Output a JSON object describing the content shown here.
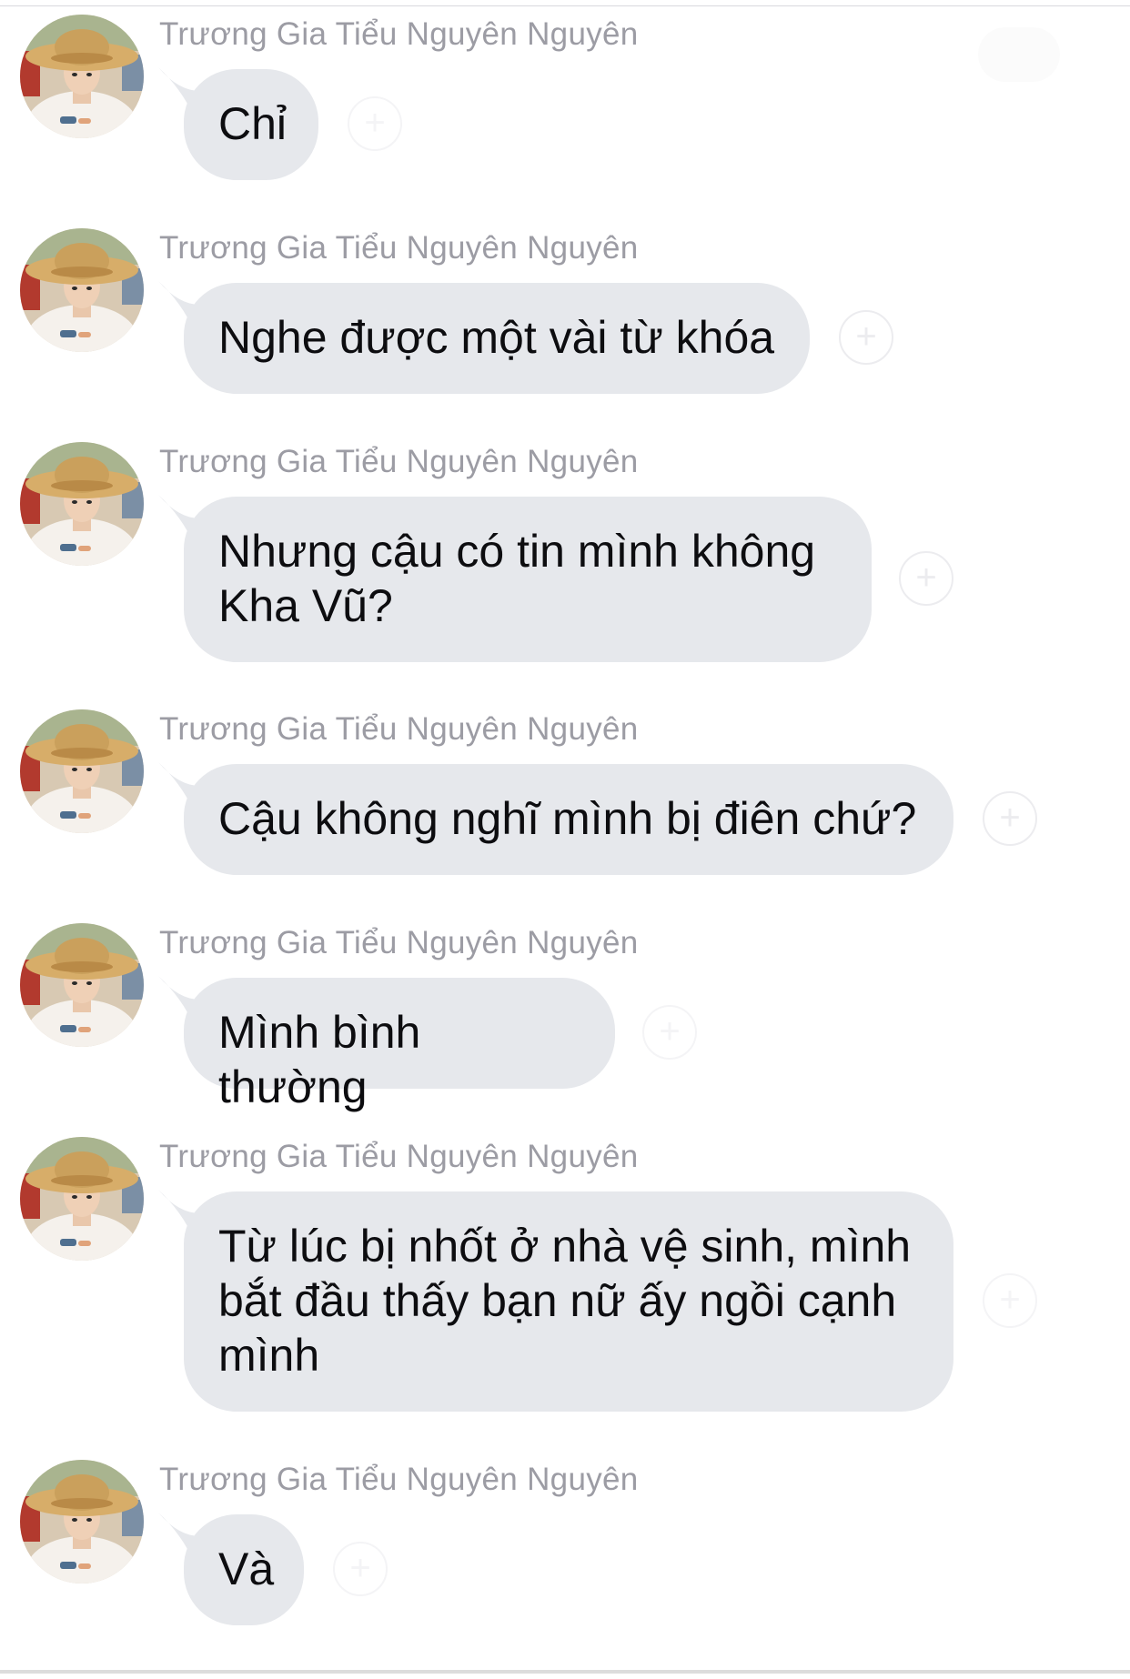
{
  "colors": {
    "bubble": "#e6e8ec",
    "sender_name": "#9c9ca4",
    "message_text": "#0d0d10",
    "react_ring": "#ececef"
  },
  "icons": {
    "add_reaction": "plus-circle-icon",
    "avatar": "profile-photo-straw-hat"
  },
  "react_glyph": "+",
  "messages": [
    {
      "sender": "Trương Gia Tiểu Nguyên Nguyên",
      "text": "Chỉ"
    },
    {
      "sender": "Trương Gia Tiểu Nguyên Nguyên",
      "text": "Nghe được một vài từ khóa"
    },
    {
      "sender": "Trương Gia Tiểu Nguyên Nguyên",
      "lines": [
        "Nhưng cậu có tin mình không",
        "Kha Vũ?"
      ]
    },
    {
      "sender": "Trương Gia Tiểu Nguyên Nguyên",
      "text": "Cậu không nghĩ mình bị điên chứ?"
    },
    {
      "sender": "Trương Gia Tiểu Nguyên Nguyên",
      "text": "Mình bình thường"
    },
    {
      "sender": "Trương Gia Tiểu Nguyên Nguyên",
      "lines": [
        "Từ lúc bị nhốt ở nhà vệ sinh, mình",
        "bắt đầu thấy bạn nữ ấy ngồi cạnh",
        "mình"
      ]
    },
    {
      "sender": "Trương Gia Tiểu Nguyên Nguyên",
      "text": "Và"
    }
  ]
}
